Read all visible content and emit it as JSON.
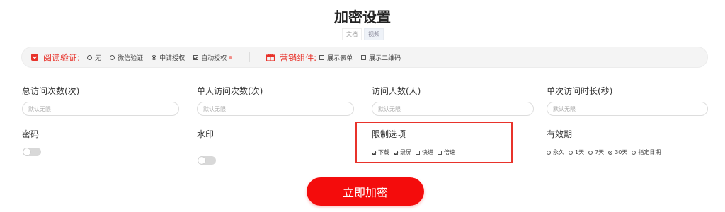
{
  "title": "加密设置",
  "tabs": [
    {
      "label": "文档"
    },
    {
      "label": "视频"
    }
  ],
  "read_verify": {
    "label": "阅读验证:",
    "options": [
      {
        "label": "无",
        "type": "radio",
        "checked": false
      },
      {
        "label": "微信验证",
        "type": "radio",
        "checked": false
      },
      {
        "label": "申请授权",
        "type": "radio",
        "checked": true
      },
      {
        "label": "自动授权",
        "type": "checkbox",
        "checked": true
      }
    ]
  },
  "marketing": {
    "label": "营销组件:",
    "options": [
      {
        "label": "展示表单",
        "checked": false
      },
      {
        "label": "展示二维码",
        "checked": false
      }
    ]
  },
  "fields": [
    {
      "label": "总访问次数(次)",
      "placeholder": "默认无限"
    },
    {
      "label": "单人访问次数(次)",
      "placeholder": "默认无限"
    },
    {
      "label": "访问人数(人)",
      "placeholder": "默认无限"
    },
    {
      "label": "单次访问时长(秒)",
      "placeholder": "默认无限"
    }
  ],
  "password": {
    "label": "密码",
    "enabled": false
  },
  "watermark": {
    "label": "水印",
    "enabled": false
  },
  "limits": {
    "label": "限制选项",
    "options": [
      {
        "label": "下载",
        "checked": true
      },
      {
        "label": "录屏",
        "checked": true
      },
      {
        "label": "快进",
        "checked": false
      },
      {
        "label": "倍速",
        "checked": false
      }
    ]
  },
  "validity": {
    "label": "有效期",
    "options": [
      {
        "label": "永久",
        "checked": false
      },
      {
        "label": "1天",
        "checked": false
      },
      {
        "label": "7天",
        "checked": false
      },
      {
        "label": "30天",
        "checked": true
      },
      {
        "label": "指定日期",
        "checked": false
      }
    ]
  },
  "submit_label": "立即加密",
  "colors": {
    "accent": "#e8332b",
    "button": "#f40c0c"
  }
}
